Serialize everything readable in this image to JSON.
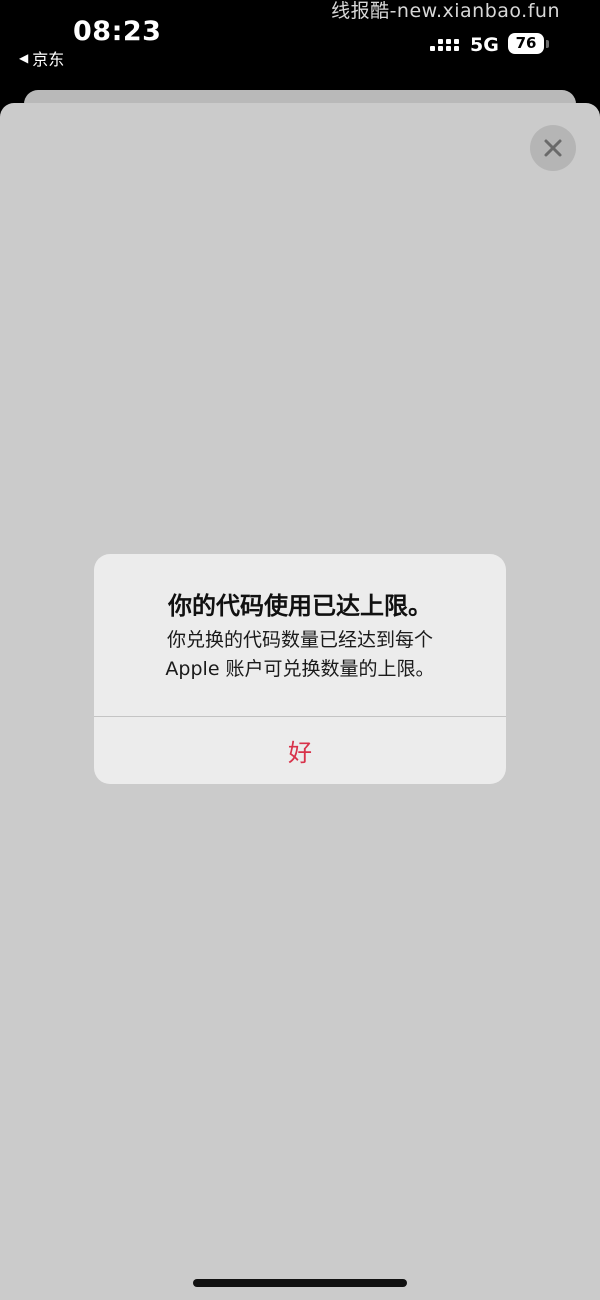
{
  "status_bar": {
    "time": "08:23",
    "back_app": "京东",
    "back_arrow_icon": "◀",
    "network": "5G",
    "battery": "76"
  },
  "watermark": "线报酷-new.xianbao.fun",
  "close_icon": "close-icon",
  "alert": {
    "title": "你的代码使用已达上限。",
    "message_line1": "你兑换的代码数量已经达到每个",
    "message_line2": "Apple 账户可兑换数量的上限。",
    "ok_label": "好"
  },
  "colors": {
    "accent": "#d8324a",
    "sheet": "#cbcbcb",
    "alert_bg": "#ececec"
  }
}
